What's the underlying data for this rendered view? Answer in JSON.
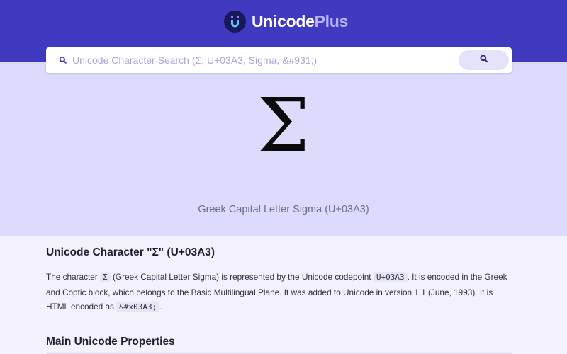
{
  "brand": {
    "part1": "Unicode",
    "part2": "Plus",
    "logo_icon": "u-logo-icon"
  },
  "search": {
    "placeholder": "Unicode Character Search (Σ, U+03A3, Sigma, &#931;)",
    "value": "",
    "input_icon": "search-icon",
    "button_icon": "search-icon"
  },
  "character": {
    "glyph": "Σ",
    "caption": "Greek Capital Letter Sigma (U+03A3)"
  },
  "section": {
    "heading": "Unicode Character \"Σ\" (U+03A3)",
    "text_1": "The character ",
    "char_code": "Σ",
    "text_2": " (Greek Capital Letter Sigma) is represented by the Unicode codepoint ",
    "codepoint_code": "U+03A3",
    "text_3": ". It is encoded in the Greek and Coptic block, which belongs to the Basic Multilingual Plane. It was added to Unicode in version 1.1 (June, 1993). It is HTML encoded as ",
    "html_code": "&#x03A3;",
    "text_4": "."
  },
  "properties": {
    "heading": "Main Unicode Properties"
  },
  "colors": {
    "header_bg": "#3f3abf",
    "hero_bg": "#dcdbfb",
    "page_bg": "#f3f2fc",
    "brand_accent": "#b7b4ff",
    "search_button_bg": "#e4e3fb"
  }
}
